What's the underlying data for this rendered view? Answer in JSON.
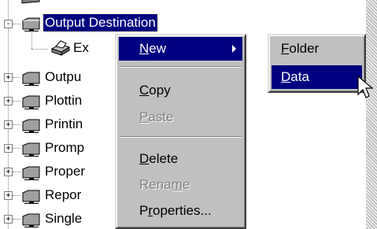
{
  "tree": {
    "selected_node": "Output Destination",
    "child_node": "Ex",
    "nodes": [
      "Outpu",
      "Plottin",
      "Printin",
      "Promp",
      "Proper",
      "Repor",
      "Single"
    ]
  },
  "context_menu": {
    "new": {
      "label": "New",
      "mnemonic_index": 0
    },
    "copy": {
      "label": "Copy",
      "mnemonic_index": 0
    },
    "paste": {
      "label": "Paste",
      "mnemonic_index": 0,
      "disabled": true
    },
    "delete": {
      "label": "Delete",
      "mnemonic_index": 0
    },
    "rename": {
      "label": "Rename",
      "mnemonic_index": 4,
      "disabled": true
    },
    "properties": {
      "label": "Properties...",
      "mnemonic_index": 1
    }
  },
  "submenu": {
    "folder": {
      "label": "Folder",
      "mnemonic_index": 0
    },
    "data": {
      "label": "Data",
      "mnemonic_index": 0
    }
  },
  "icons": {
    "expander_collapsed": "+",
    "expander_expanded": "-"
  },
  "colors": {
    "highlight": "#000080",
    "menu_face": "#c0c0c0",
    "disabled_text": "#808080"
  }
}
